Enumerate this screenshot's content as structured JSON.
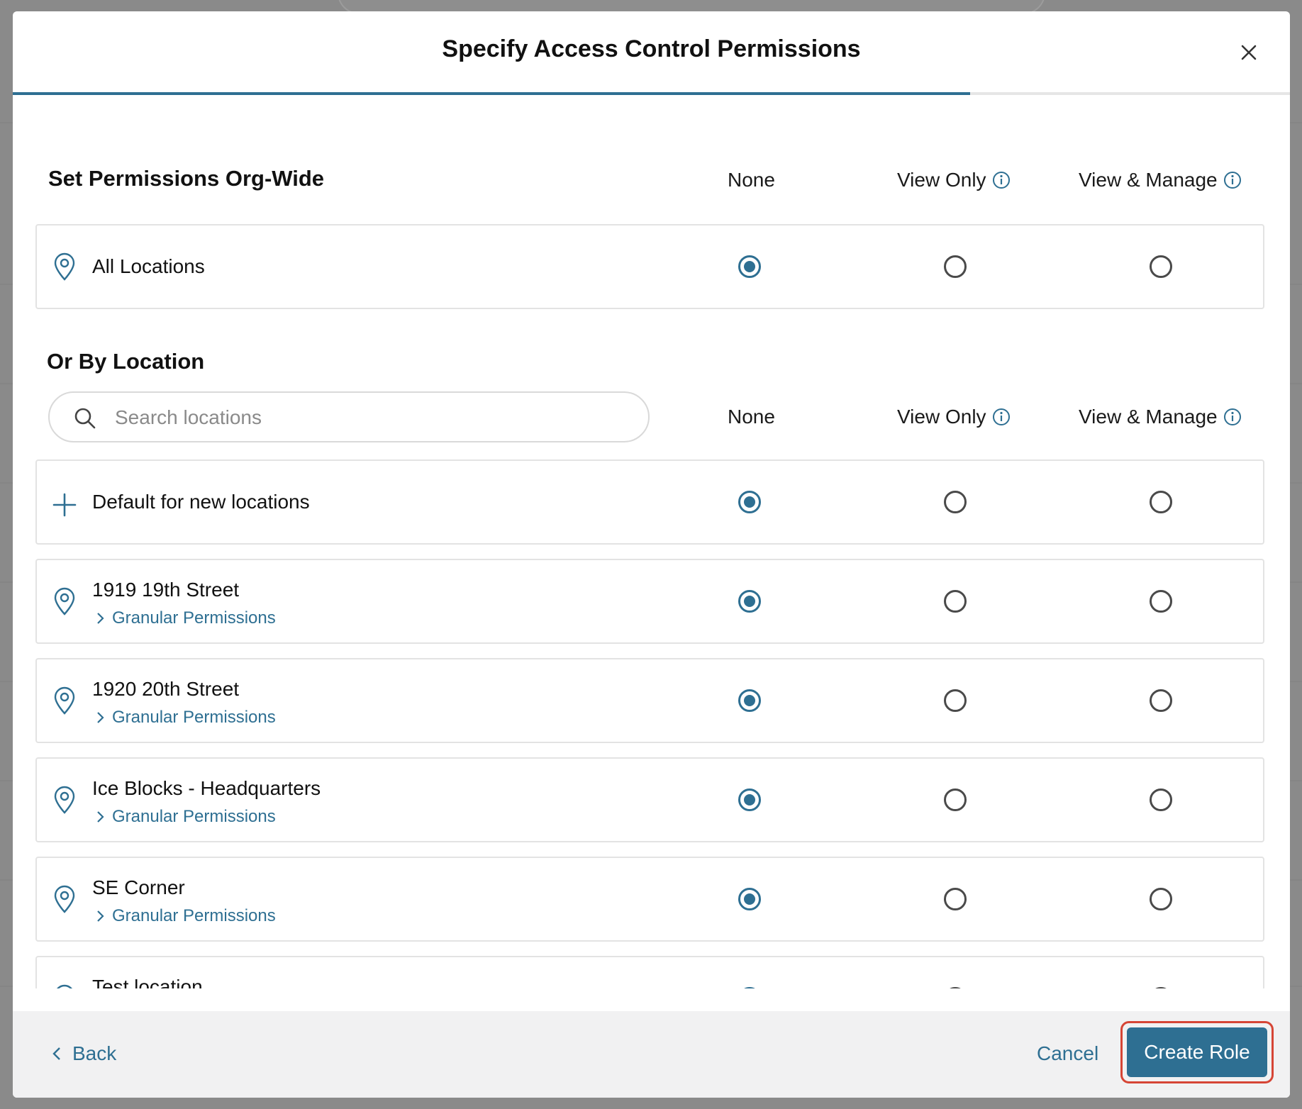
{
  "modal": {
    "title": "Specify Access Control Permissions"
  },
  "org_wide": {
    "title": "Set Permissions Org-Wide",
    "columns": [
      "None",
      "View Only",
      "View & Manage"
    ],
    "row": {
      "label": "All Locations",
      "selected": "None"
    }
  },
  "by_location": {
    "title": "Or By Location",
    "search_placeholder": "Search locations",
    "columns": [
      "None",
      "View Only",
      "View & Manage"
    ],
    "default_row": {
      "label": "Default for new locations",
      "selected": "None"
    },
    "rows": [
      {
        "label": "1919 19th Street",
        "sub": "Granular Permissions",
        "selected": "None"
      },
      {
        "label": "1920 20th Street",
        "sub": "Granular Permissions",
        "selected": "None"
      },
      {
        "label": "Ice Blocks - Headquarters",
        "sub": "Granular Permissions",
        "selected": "None"
      },
      {
        "label": "SE Corner",
        "sub": "Granular Permissions",
        "selected": "None"
      },
      {
        "label": "Test location",
        "sub": "",
        "selected": "None"
      }
    ]
  },
  "footer": {
    "back_label": "Back",
    "cancel_label": "Cancel",
    "create_label": "Create Role"
  },
  "colors": {
    "accent": "#2e6f92",
    "highlight": "#d64535"
  }
}
